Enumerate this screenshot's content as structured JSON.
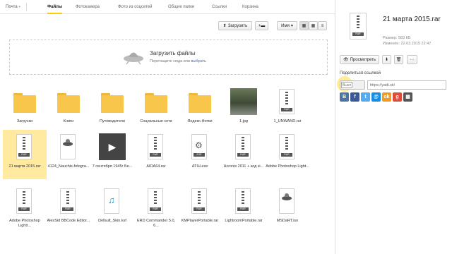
{
  "topbar": {
    "mail": "Почта",
    "tabs": [
      "Файлы",
      "Фотокамера",
      "Фото из соцсетей",
      "Общие папки",
      "Ссылки",
      "Корзина"
    ]
  },
  "toolbar": {
    "upload": "Загрузить",
    "sort": "Имя"
  },
  "upload_zone": {
    "title": "Загрузить файлы",
    "hint": "Перетащите сюда или",
    "link": "выбрать"
  },
  "files": [
    {
      "label": "Загрузки",
      "kind": "folder"
    },
    {
      "label": "Книги",
      "kind": "folder"
    },
    {
      "label": "Путеводители",
      "kind": "folder"
    },
    {
      "label": "Социальные сети",
      "kind": "folder"
    },
    {
      "label": "Яндекс.Фотки",
      "kind": "folder"
    },
    {
      "label": "1.jpg",
      "kind": "photo"
    },
    {
      "label": "1_UNWAND.rar",
      "kind": "rar"
    },
    {
      "label": "21 марта 2015.rar",
      "kind": "rar"
    },
    {
      "label": "4124_Nauchis-fotogra...",
      "kind": "iso"
    },
    {
      "label": "7 сентября 1945г Бе...",
      "kind": "video"
    },
    {
      "label": "AIDA64.rar",
      "kind": "rar"
    },
    {
      "label": "ATIH.exe",
      "kind": "exe"
    },
    {
      "label": "Acronis 2011 + код зі...",
      "kind": "rar"
    },
    {
      "label": "Adobe Photoshop Light...",
      "kind": "rar"
    },
    {
      "label": "Adobe Photoshop Lightr...",
      "kind": "rar"
    },
    {
      "label": "AlexSid BBCode Editor...",
      "kind": "rar"
    },
    {
      "label": "Default_Skin.ksf",
      "kind": "audio"
    },
    {
      "label": "ERD Commander 5.0, 6...",
      "kind": "rar"
    },
    {
      "label": "KMPlayerPortable.rar",
      "kind": "rar"
    },
    {
      "label": "LightroomPortable.rar",
      "kind": "rar"
    },
    {
      "label": "MSDaRT.iso",
      "kind": "iso"
    }
  ],
  "file_tag": "RAR",
  "details": {
    "name": "21 марта 2015.rar",
    "size": "Размер: 583 КБ",
    "date": "Изменён: 22.03.2015 22:47",
    "view_btn": "Просмотреть",
    "share_label": "Поделиться ссылкой",
    "toggle_off": "Выкл",
    "link": "https://yadi.sk/"
  },
  "social": [
    {
      "name": "vk",
      "letter": "В",
      "color": "#4c75a3"
    },
    {
      "name": "facebook",
      "letter": "f",
      "color": "#3b5998"
    },
    {
      "name": "twitter",
      "letter": "t",
      "color": "#55acee"
    },
    {
      "name": "mailru",
      "letter": "@",
      "color": "#168de2"
    },
    {
      "name": "odnoklassniki",
      "letter": "ok",
      "color": "#f59a1b"
    },
    {
      "name": "google",
      "letter": "g",
      "color": "#dd4b39"
    },
    {
      "name": "qr",
      "letter": "▦",
      "color": "#555555"
    }
  ],
  "colors": {
    "accent": "#ffcc00",
    "folder": "#f7c64a",
    "selected": "#ffeaa0"
  }
}
